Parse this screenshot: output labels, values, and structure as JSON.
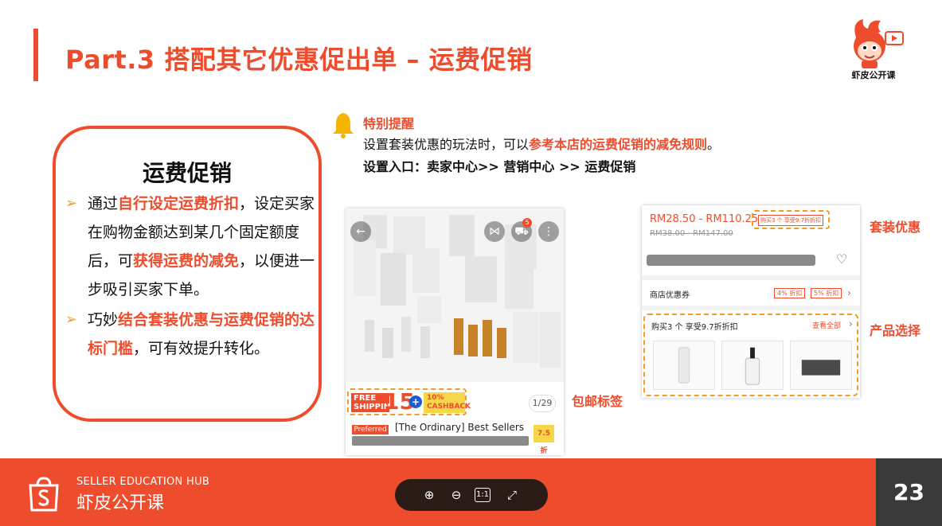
{
  "slide": {
    "title": "Part.3 搭配其它优惠促出单 – 运费促销",
    "page_number": "23",
    "brand_label": "虾皮公开课"
  },
  "card": {
    "title": "运费促销",
    "bullet1": {
      "pre": "通过",
      "hl1": "自行设定运费折扣",
      "mid": "，设定买家在购物金额达到某几个固定额度后，可",
      "hl2": "获得运费的减免",
      "post": "，以便进一步吸引买家下单。"
    },
    "bullet2": {
      "pre": "巧妙",
      "hl": "结合套装优惠与运费促销的达标门槛",
      "post": "，可有效提升转化。"
    }
  },
  "notice": {
    "title": "特别提醒",
    "line1_pre": "设置套装优惠的玩法时，可以",
    "line1_hl": "参考本店的运费促销的减免规则",
    "line1_post": "。",
    "line2": "设置入口：卖家中心>> 营销中心 >> 运费促销"
  },
  "screenshot1": {
    "free_text": "FREE SHIPPING",
    "free_amount": "15",
    "plus": "+",
    "cashback": "10% CASHBACK",
    "page_indicator": "1/29",
    "preferred": "Preferred",
    "product_name": "[The Ordinary] Best Sellers",
    "discount": "7.5 折",
    "cart_count": "5",
    "label": "包邮标签"
  },
  "screenshot2": {
    "price": "RM28.50 - RM110.25",
    "price_old": "RM38.00 - RM147.00",
    "bundle_tag": "购买3 个 享受9.7折折扣",
    "voucher_label": "商店优惠券",
    "voucher1": "4% 折扣",
    "voucher2": "5% 折扣",
    "bundle_desc": "购买3 个 享受9.7折折扣",
    "see_all": "查看全部",
    "label_bundle": "套装优惠",
    "label_select": "产品选择"
  },
  "footer": {
    "hub_en": "SELLER EDUCATION HUB",
    "hub_cn": "虾皮公开课"
  },
  "colors": {
    "brand": "#ee4d2d",
    "highlight": "#f59a23",
    "footer_dark": "#3a3a3a"
  }
}
